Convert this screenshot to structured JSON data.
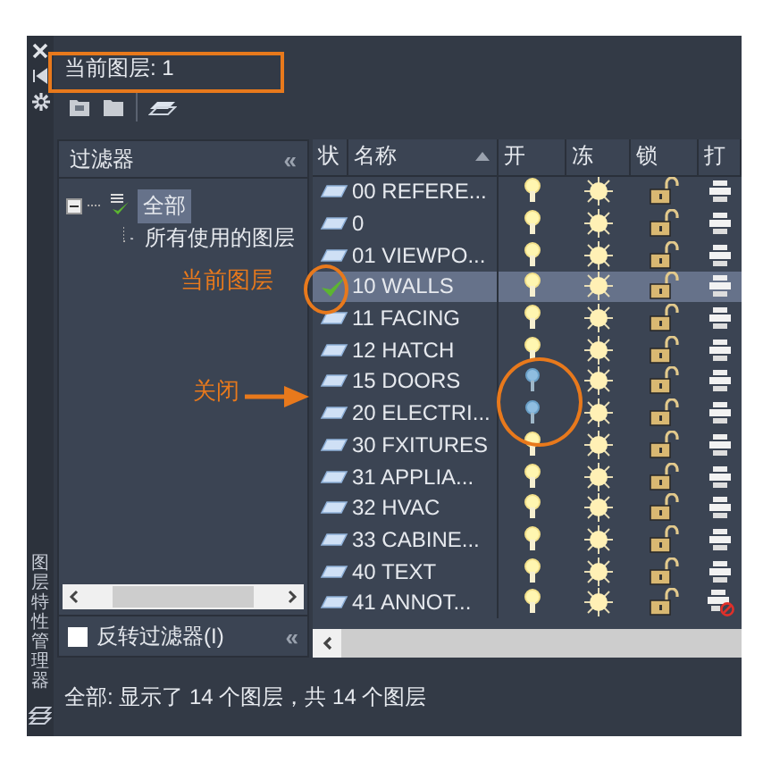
{
  "side_strip": {
    "title": "图层特性管理器"
  },
  "current_layer": {
    "label": "当前图层: 1"
  },
  "filters": {
    "title": "过滤器",
    "collapse": "«",
    "tree": [
      {
        "label": "全部",
        "selected": true,
        "children": [
          {
            "label": "所有使用的图层",
            "selected": false
          }
        ]
      }
    ],
    "invert": {
      "label": "反转过滤器(I)",
      "checked": false
    },
    "invert_collapse": "«"
  },
  "table": {
    "columns": [
      "状",
      "名称",
      "开",
      "冻",
      "锁",
      "打"
    ],
    "rows": [
      {
        "name": "00 REFERE...",
        "selected": false,
        "current": false,
        "on": true,
        "frozen": false,
        "locked": false,
        "plot": true
      },
      {
        "name": "0",
        "selected": false,
        "current": false,
        "on": true,
        "frozen": false,
        "locked": false,
        "plot": true
      },
      {
        "name": "01 VIEWPO...",
        "selected": false,
        "current": false,
        "on": true,
        "frozen": false,
        "locked": false,
        "plot": true
      },
      {
        "name": "10 WALLS",
        "selected": true,
        "current": true,
        "on": true,
        "frozen": false,
        "locked": false,
        "plot": true
      },
      {
        "name": "11 FACING",
        "selected": false,
        "current": false,
        "on": true,
        "frozen": false,
        "locked": false,
        "plot": true
      },
      {
        "name": "12 HATCH",
        "selected": false,
        "current": false,
        "on": true,
        "frozen": false,
        "locked": false,
        "plot": true
      },
      {
        "name": "15 DOORS",
        "selected": false,
        "current": false,
        "on": false,
        "frozen": false,
        "locked": false,
        "plot": true
      },
      {
        "name": "20 ELECTRI...",
        "selected": false,
        "current": false,
        "on": false,
        "frozen": false,
        "locked": false,
        "plot": true
      },
      {
        "name": "30 FXITURES",
        "selected": false,
        "current": false,
        "on": true,
        "frozen": false,
        "locked": false,
        "plot": true
      },
      {
        "name": "31  APPLIA...",
        "selected": false,
        "current": false,
        "on": true,
        "frozen": false,
        "locked": false,
        "plot": true
      },
      {
        "name": "32 HVAC",
        "selected": false,
        "current": false,
        "on": true,
        "frozen": false,
        "locked": false,
        "plot": true
      },
      {
        "name": "33 CABINE...",
        "selected": false,
        "current": false,
        "on": true,
        "frozen": false,
        "locked": false,
        "plot": true
      },
      {
        "name": "40 TEXT",
        "selected": false,
        "current": false,
        "on": true,
        "frozen": false,
        "locked": false,
        "plot": true
      },
      {
        "name": "41 ANNOT...",
        "selected": false,
        "current": false,
        "on": true,
        "frozen": false,
        "locked": false,
        "plot": false
      }
    ]
  },
  "status_bar": "全部: 显示了 14 个图层，共 14 个图层",
  "annotations": [
    {
      "text": "当前图层"
    },
    {
      "text": "关闭"
    }
  ]
}
